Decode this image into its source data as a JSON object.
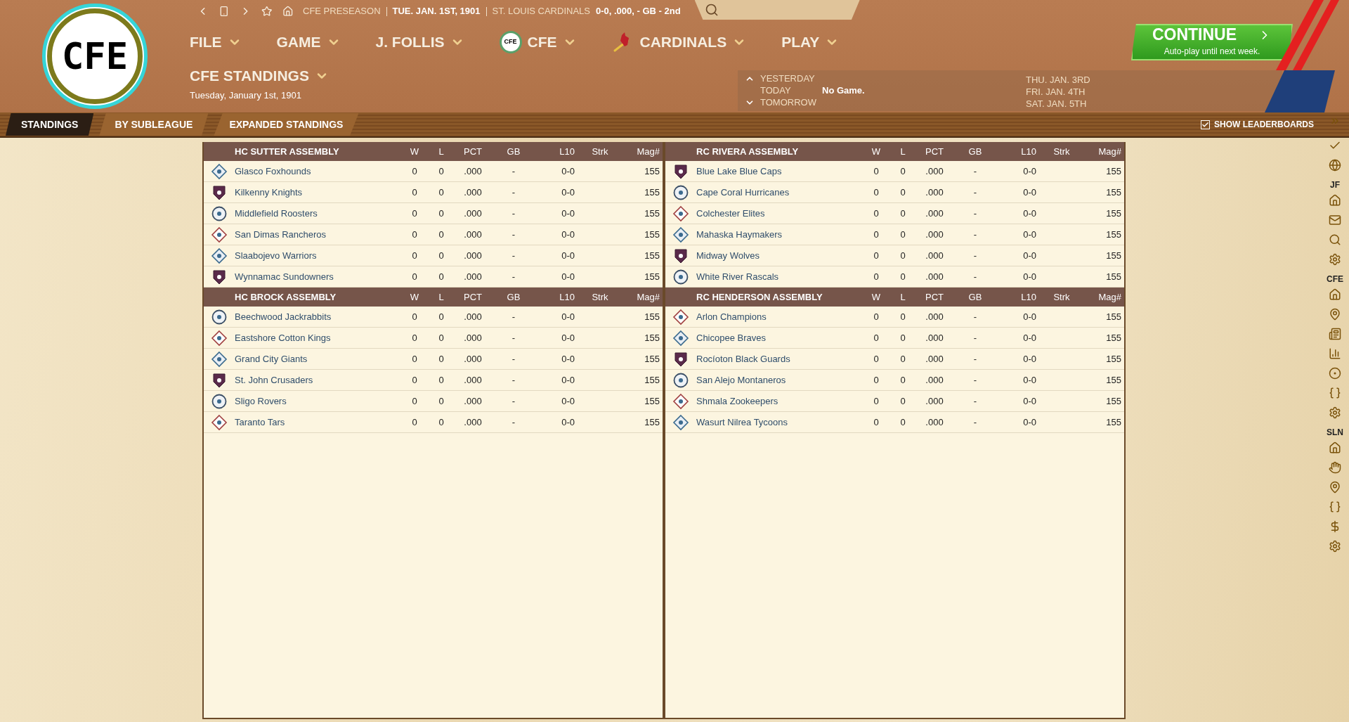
{
  "logo": {
    "text": "CFE"
  },
  "top_bar": {
    "segments": [
      {
        "text": "CFE PRESEASON",
        "kind": "muted"
      },
      {
        "text": "TUE. JAN. 1ST, 1901",
        "kind": "strong"
      },
      {
        "text": "ST. LOUIS CARDINALS",
        "kind": "muted"
      },
      {
        "text": "0-0, .000, - GB - 2nd",
        "kind": "strong"
      }
    ]
  },
  "menu": [
    {
      "label": "FILE",
      "kind": "text"
    },
    {
      "label": "GAME",
      "kind": "text"
    },
    {
      "label": "J. FOLLIS",
      "kind": "text"
    },
    {
      "label": "CFE",
      "kind": "league",
      "badge": "CFE"
    },
    {
      "label": "CARDINALS",
      "kind": "team"
    },
    {
      "label": "PLAY",
      "kind": "text"
    }
  ],
  "page": {
    "title": "CFE STANDINGS",
    "date": "Tuesday, January 1st, 1901"
  },
  "continue_button": {
    "label": "CONTINUE",
    "subtitle": "Auto-play until next week."
  },
  "schedule": {
    "days": [
      {
        "label": "YESTERDAY",
        "kind": "up"
      },
      {
        "label": "TODAY",
        "kind": "none",
        "value": "No Game."
      },
      {
        "label": "TOMORROW",
        "kind": "down"
      }
    ],
    "upcoming": [
      "THU. JAN. 3RD",
      "FRI. JAN. 4TH",
      "SAT. JAN. 5TH"
    ]
  },
  "tabs": [
    {
      "label": "STANDINGS",
      "selected": true
    },
    {
      "label": "BY SUBLEAGUE",
      "selected": false
    },
    {
      "label": "EXPANDED STANDINGS",
      "selected": false
    }
  ],
  "show_leaderboards": {
    "label": "SHOW LEADERBOARDS",
    "checked": true
  },
  "panels": [
    {
      "divisions": [
        {
          "name": "HC SUTTER ASSEMBLY",
          "columns": [
            "W",
            "L",
            "PCT",
            "GB",
            "L10",
            "Strk",
            "Mag#"
          ],
          "teams": [
            {
              "name": "Glasco Foxhounds",
              "w": "0",
              "l": "0",
              "pct": ".000",
              "gb": "-",
              "l10": "0-0",
              "mag": "155"
            },
            {
              "name": "Kilkenny Knights",
              "w": "0",
              "l": "0",
              "pct": ".000",
              "gb": "-",
              "l10": "0-0",
              "mag": "155"
            },
            {
              "name": "Middlefield Roosters",
              "w": "0",
              "l": "0",
              "pct": ".000",
              "gb": "-",
              "l10": "0-0",
              "mag": "155"
            },
            {
              "name": "San Dimas Rancheros",
              "w": "0",
              "l": "0",
              "pct": ".000",
              "gb": "-",
              "l10": "0-0",
              "mag": "155"
            },
            {
              "name": "Slaabojevo Warriors",
              "w": "0",
              "l": "0",
              "pct": ".000",
              "gb": "-",
              "l10": "0-0",
              "mag": "155"
            },
            {
              "name": "Wynnamac Sundowners",
              "w": "0",
              "l": "0",
              "pct": ".000",
              "gb": "-",
              "l10": "0-0",
              "mag": "155"
            }
          ]
        },
        {
          "name": "HC BROCK ASSEMBLY",
          "columns": [
            "W",
            "L",
            "PCT",
            "GB",
            "L10",
            "Strk",
            "Mag#"
          ],
          "teams": [
            {
              "name": "Beechwood Jackrabbits",
              "w": "0",
              "l": "0",
              "pct": ".000",
              "gb": "-",
              "l10": "0-0",
              "mag": "155"
            },
            {
              "name": "Eastshore Cotton Kings",
              "w": "0",
              "l": "0",
              "pct": ".000",
              "gb": "-",
              "l10": "0-0",
              "mag": "155"
            },
            {
              "name": "Grand City Giants",
              "w": "0",
              "l": "0",
              "pct": ".000",
              "gb": "-",
              "l10": "0-0",
              "mag": "155"
            },
            {
              "name": "St. John Crusaders",
              "w": "0",
              "l": "0",
              "pct": ".000",
              "gb": "-",
              "l10": "0-0",
              "mag": "155"
            },
            {
              "name": "Sligo Rovers",
              "w": "0",
              "l": "0",
              "pct": ".000",
              "gb": "-",
              "l10": "0-0",
              "mag": "155"
            },
            {
              "name": "Taranto Tars",
              "w": "0",
              "l": "0",
              "pct": ".000",
              "gb": "-",
              "l10": "0-0",
              "mag": "155"
            }
          ]
        }
      ]
    },
    {
      "divisions": [
        {
          "name": "RC RIVERA ASSEMBLY",
          "columns": [
            "W",
            "L",
            "PCT",
            "GB",
            "L10",
            "Strk",
            "Mag#"
          ],
          "teams": [
            {
              "name": "Blue Lake Blue Caps",
              "w": "0",
              "l": "0",
              "pct": ".000",
              "gb": "-",
              "l10": "0-0",
              "mag": "155"
            },
            {
              "name": "Cape Coral Hurricanes",
              "w": "0",
              "l": "0",
              "pct": ".000",
              "gb": "-",
              "l10": "0-0",
              "mag": "155"
            },
            {
              "name": "Colchester Elites",
              "w": "0",
              "l": "0",
              "pct": ".000",
              "gb": "-",
              "l10": "0-0",
              "mag": "155"
            },
            {
              "name": "Mahaska Haymakers",
              "w": "0",
              "l": "0",
              "pct": ".000",
              "gb": "-",
              "l10": "0-0",
              "mag": "155"
            },
            {
              "name": "Midway Wolves",
              "w": "0",
              "l": "0",
              "pct": ".000",
              "gb": "-",
              "l10": "0-0",
              "mag": "155"
            },
            {
              "name": "White River Rascals",
              "w": "0",
              "l": "0",
              "pct": ".000",
              "gb": "-",
              "l10": "0-0",
              "mag": "155"
            }
          ]
        },
        {
          "name": "RC HENDERSON ASSEMBLY",
          "columns": [
            "W",
            "L",
            "PCT",
            "GB",
            "L10",
            "Strk",
            "Mag#"
          ],
          "teams": [
            {
              "name": "Arlon Champions",
              "w": "0",
              "l": "0",
              "pct": ".000",
              "gb": "-",
              "l10": "0-0",
              "mag": "155"
            },
            {
              "name": "Chicopee Braves",
              "w": "0",
              "l": "0",
              "pct": ".000",
              "gb": "-",
              "l10": "0-0",
              "mag": "155"
            },
            {
              "name": "Rocíoton Black Guards",
              "w": "0",
              "l": "0",
              "pct": ".000",
              "gb": "-",
              "l10": "0-0",
              "mag": "155"
            },
            {
              "name": "San Alejo Montaneros",
              "w": "0",
              "l": "0",
              "pct": ".000",
              "gb": "-",
              "l10": "0-0",
              "mag": "155"
            },
            {
              "name": "Shmala Zookeepers",
              "w": "0",
              "l": "0",
              "pct": ".000",
              "gb": "-",
              "l10": "0-0",
              "mag": "155"
            },
            {
              "name": "Wasurt Nilrea Tycoons",
              "w": "0",
              "l": "0",
              "pct": ".000",
              "gb": "-",
              "l10": "0-0",
              "mag": "155"
            }
          ]
        }
      ]
    }
  ],
  "sidebar": {
    "sections": [
      {
        "label": "JF"
      },
      {
        "label": "CFE"
      },
      {
        "label": "SLN"
      }
    ]
  }
}
